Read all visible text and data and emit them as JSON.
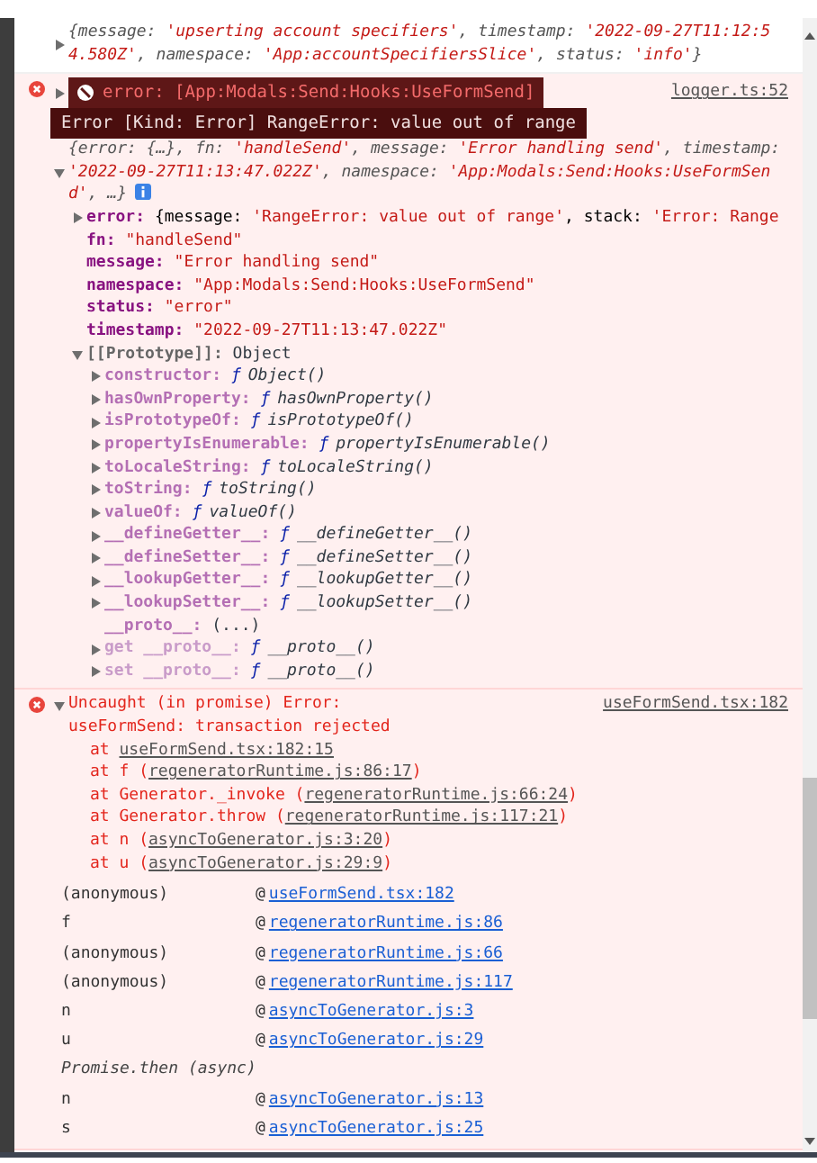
{
  "info_message": {
    "expanded": false,
    "preview": [
      {
        "kind": "plain",
        "text": "{message: "
      },
      {
        "kind": "string",
        "text": "'upserting account specifiers'"
      },
      {
        "kind": "plain",
        "text": ", timestamp: "
      },
      {
        "kind": "string",
        "text": "'2022-09-27T11:12:54.580Z'"
      },
      {
        "kind": "plain",
        "text": ", namespace: "
      },
      {
        "kind": "string",
        "text": "'App:accountSpecifiersSlice'"
      },
      {
        "kind": "plain",
        "text": ", status: "
      },
      {
        "kind": "string",
        "text": "'info'"
      },
      {
        "kind": "plain",
        "text": "}"
      }
    ]
  },
  "logged_error": {
    "source": "logger.ts:52",
    "badge": {
      "text": "error: [App:Modals:Send:Hooks:UseFormSend]",
      "expanded": false
    },
    "detail_badge": "Error [Kind: Error] RangeError: value out of range",
    "expanded": true,
    "preview": [
      {
        "kind": "plain",
        "text": "{error: {…}, fn: "
      },
      {
        "kind": "string",
        "text": "'handleSend'"
      },
      {
        "kind": "plain",
        "text": ", message: "
      },
      {
        "kind": "string",
        "text": "'Error handling send'"
      },
      {
        "kind": "plain",
        "text": ", timestamp: "
      },
      {
        "kind": "string",
        "text": "'2022-09-27T11:13:47.022Z'"
      },
      {
        "kind": "plain",
        "text": ", namespace: "
      },
      {
        "kind": "string",
        "text": "'App:Modals:Send:Hooks:UseFormSend'"
      },
      {
        "kind": "plain",
        "text": ", …}"
      }
    ],
    "properties": [
      {
        "key": "error:",
        "kind": "object",
        "expanded": false,
        "value_parts": [
          {
            "kind": "plain",
            "text": "{message: "
          },
          {
            "kind": "string",
            "text": "'RangeError: value out of range'"
          },
          {
            "kind": "plain",
            "text": ", stack: "
          },
          {
            "kind": "string",
            "text": "'Error: Range"
          }
        ]
      },
      {
        "key": "fn:",
        "kind": "string",
        "value": "\"handleSend\""
      },
      {
        "key": "message:",
        "kind": "string",
        "value": "\"Error handling send\""
      },
      {
        "key": "namespace:",
        "kind": "string",
        "value": "\"App:Modals:Send:Hooks:UseFormSend\""
      },
      {
        "key": "status:",
        "kind": "string",
        "value": "\"error\""
      },
      {
        "key": "timestamp:",
        "kind": "string",
        "value": "\"2022-09-27T11:13:47.022Z\""
      },
      {
        "key": "[[Prototype]]:",
        "kind": "internal",
        "expanded": true,
        "value": "Object",
        "children": [
          {
            "key": "constructor:",
            "kind": "function",
            "expanded": false,
            "fn_mark": "ƒ",
            "value": "Object()"
          },
          {
            "key": "hasOwnProperty:",
            "kind": "function",
            "expanded": false,
            "fn_mark": "ƒ",
            "value": "hasOwnProperty()"
          },
          {
            "key": "isPrototypeOf:",
            "kind": "function",
            "expanded": false,
            "fn_mark": "ƒ",
            "value": "isPrototypeOf()"
          },
          {
            "key": "propertyIsEnumerable:",
            "kind": "function",
            "expanded": false,
            "fn_mark": "ƒ",
            "value": "propertyIsEnumerable()"
          },
          {
            "key": "toLocaleString:",
            "kind": "function",
            "expanded": false,
            "fn_mark": "ƒ",
            "value": "toLocaleString()"
          },
          {
            "key": "toString:",
            "kind": "function",
            "expanded": false,
            "fn_mark": "ƒ",
            "value": "toString()"
          },
          {
            "key": "valueOf:",
            "kind": "function",
            "expanded": false,
            "fn_mark": "ƒ",
            "value": "valueOf()"
          },
          {
            "key": "__defineGetter__:",
            "kind": "function",
            "expanded": false,
            "fn_mark": "ƒ",
            "value": "__defineGetter__()"
          },
          {
            "key": "__defineSetter__:",
            "kind": "function",
            "expanded": false,
            "fn_mark": "ƒ",
            "value": "__defineSetter__()"
          },
          {
            "key": "__lookupGetter__:",
            "kind": "function",
            "expanded": false,
            "fn_mark": "ƒ",
            "value": "__lookupGetter__()"
          },
          {
            "key": "__lookupSetter__:",
            "kind": "function",
            "expanded": false,
            "fn_mark": "ƒ",
            "value": "__lookupSetter__()"
          },
          {
            "key": "__proto__:",
            "kind": "plain",
            "value": "(...)"
          },
          {
            "key": "get __proto__:",
            "kind": "accessor",
            "expanded": false,
            "fn_mark": "ƒ",
            "value": "__proto__()"
          },
          {
            "key": "set __proto__:",
            "kind": "accessor",
            "expanded": false,
            "fn_mark": "ƒ",
            "value": "__proto__()"
          }
        ]
      }
    ]
  },
  "uncaught_error": {
    "expanded": true,
    "message": "Uncaught (in promise) Error: useFormSend: transaction rejected",
    "source": "useFormSend.tsx:182",
    "stack": [
      {
        "before": "at ",
        "link": "useFormSend.tsx:182:15"
      },
      {
        "before": "at f (",
        "link": "regeneratorRuntime.js:86:17",
        "after": ")"
      },
      {
        "before": "at Generator._invoke (",
        "link": "regeneratorRuntime.js:66:24",
        "after": ")"
      },
      {
        "before": "at Generator.throw (",
        "link": "regeneratorRuntime.js:117:21",
        "after": ")"
      },
      {
        "before": "at n (",
        "link": "asyncToGenerator.js:3:20",
        "after": ")"
      },
      {
        "before": "at u (",
        "link": "asyncToGenerator.js:29:9",
        "after": ")"
      }
    ],
    "call_stack": [
      {
        "kind": "frame",
        "func": "(anonymous)",
        "at": "@",
        "link": "useFormSend.tsx:182"
      },
      {
        "kind": "frame",
        "func": "f",
        "at": "@",
        "link": "regeneratorRuntime.js:86"
      },
      {
        "kind": "frame",
        "func": "(anonymous)",
        "at": "@",
        "link": "regeneratorRuntime.js:66"
      },
      {
        "kind": "frame",
        "func": "(anonymous)",
        "at": "@",
        "link": "regeneratorRuntime.js:117"
      },
      {
        "kind": "frame",
        "func": "n",
        "at": "@",
        "link": "asyncToGenerator.js:3"
      },
      {
        "kind": "frame",
        "func": "u",
        "at": "@",
        "link": "asyncToGenerator.js:29"
      },
      {
        "kind": "async",
        "label": "Promise.then (async)"
      },
      {
        "kind": "frame",
        "func": "n",
        "at": "@",
        "link": "asyncToGenerator.js:13"
      },
      {
        "kind": "frame",
        "func": "s",
        "at": "@",
        "link": "asyncToGenerator.js:25"
      }
    ]
  }
}
